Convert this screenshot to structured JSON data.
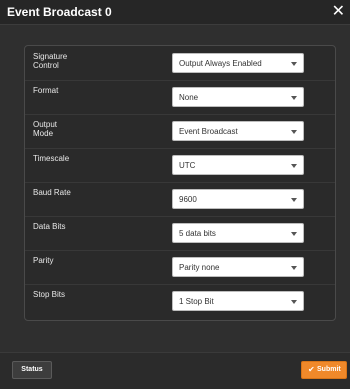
{
  "dialog": {
    "title": "Event Broadcast 0",
    "close_glyph": "✕"
  },
  "fields": [
    {
      "label": "Signature\nControl",
      "value": "Output Always Enabled"
    },
    {
      "label": "Format",
      "value": "None"
    },
    {
      "label": "Output\nMode",
      "value": "Event Broadcast"
    },
    {
      "label": "Timescale",
      "value": "UTC"
    },
    {
      "label": "Baud Rate",
      "value": "9600"
    },
    {
      "label": "Data Bits",
      "value": "5 data bits"
    },
    {
      "label": "Parity",
      "value": "Parity none"
    },
    {
      "label": "Stop Bits",
      "value": "1 Stop Bit"
    }
  ],
  "footer": {
    "status_label": "Status",
    "submit_label": "Submit",
    "submit_icon": "check-icon",
    "submit_color": "#f0892a"
  }
}
